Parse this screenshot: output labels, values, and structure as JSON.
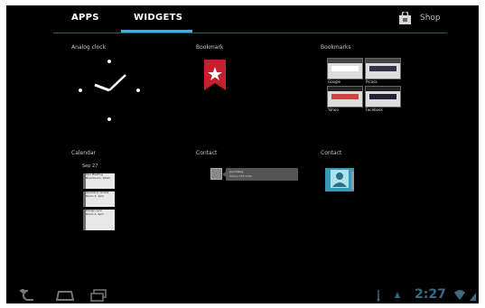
{
  "tabs": {
    "apps_label": "APPS",
    "widgets_label": "WIDGETS",
    "active": "WIDGETS"
  },
  "shop": {
    "label": "Shop",
    "icon": "shop-bag-icon"
  },
  "widgets": [
    {
      "id": "analog_clock",
      "label": "Analog clock"
    },
    {
      "id": "bookmark",
      "label": "Bookmark"
    },
    {
      "id": "bookmarks",
      "label": "Bookmarks"
    },
    {
      "id": "calendar",
      "label": "Calendar"
    },
    {
      "id": "contact_1",
      "label": "Contact"
    },
    {
      "id": "contact_2",
      "label": "Contact"
    }
  ],
  "calendar_preview": {
    "date": "Sep 27",
    "events": [
      {
        "title": "Ops Meeting",
        "detail": "Boardroom, 10am"
      },
      {
        "title": "Quarterly review",
        "detail": "Room 3, 1pm"
      },
      {
        "title": "Design sync",
        "detail": "Room 2, 4pm"
      }
    ]
  },
  "bookmarks_preview": [
    {
      "caption": "Google"
    },
    {
      "caption": "Picasa"
    },
    {
      "caption": "Yahoo"
    },
    {
      "caption": "Facebook"
    }
  ],
  "contact_preview": {
    "name": "Joe Chang",
    "detail": "Mobile 555 0100"
  },
  "status_bar": {
    "time": "2:27",
    "icons": [
      "usb-icon",
      "sync-icon",
      "wifi-icon",
      "signal-icon"
    ]
  },
  "nav": {
    "icons": [
      "back-icon",
      "home-icon",
      "recent-apps-icon"
    ]
  },
  "colors": {
    "accent": "#33b5e5",
    "bookmark_red": "#c4202f",
    "background": "#000000"
  }
}
